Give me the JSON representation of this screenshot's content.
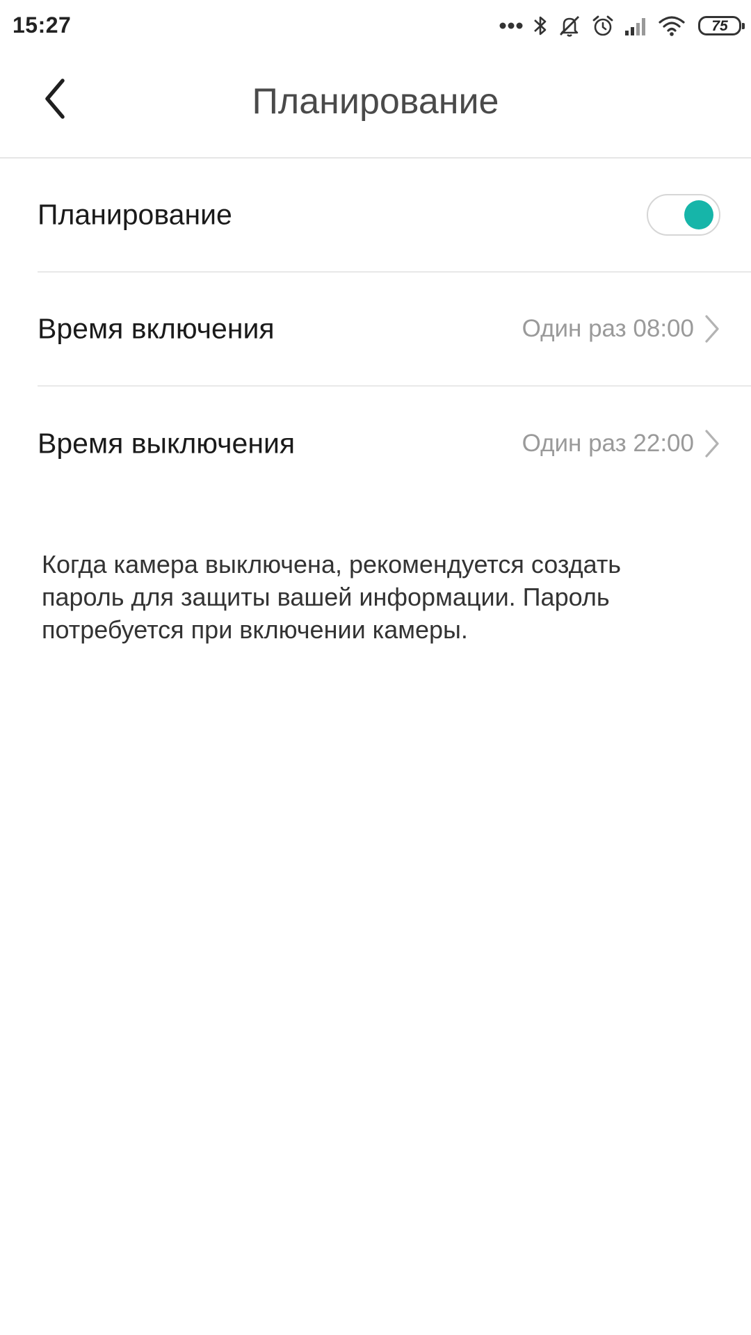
{
  "status_bar": {
    "time": "15:27",
    "battery": "75",
    "icons": [
      "more-dots-icon",
      "bluetooth-icon",
      "silent-icon",
      "alarm-icon",
      "signal-icon",
      "wifi-icon",
      "battery-icon"
    ]
  },
  "header": {
    "title": "Планирование",
    "back_icon": "back-arrow-icon"
  },
  "settings": {
    "schedule": {
      "label": "Планирование",
      "enabled": true,
      "toggle_color": "#16b5a9"
    },
    "on_time": {
      "label": "Время включения",
      "value": "Один раз 08:00"
    },
    "off_time": {
      "label": "Время выключения",
      "value": "Один раз 22:00"
    }
  },
  "info": {
    "text": "Когда камера выключена, рекомендуется создать пароль для защиты вашей информации. Пароль потребуется при включении камеры."
  }
}
